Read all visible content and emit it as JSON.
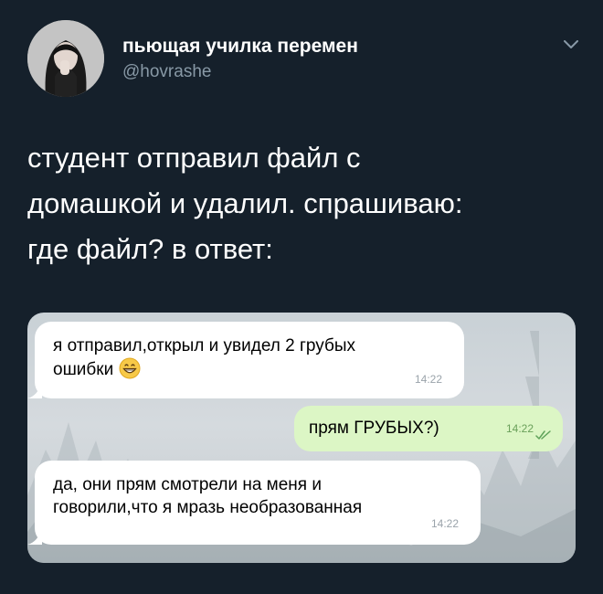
{
  "tweet": {
    "display_name": "пьющая училка перемен",
    "handle": "@hovrashe",
    "text_lines": [
      "студент отправил файл с",
      "домашкой и удалил. спрашиваю:",
      "где файл? в ответ:"
    ]
  },
  "chat": {
    "messages": [
      {
        "lines": [
          "я отправил,открыл и увидел 2 грубых",
          "ошибки"
        ],
        "time": "14:22",
        "emoji": "grinning-face-emoji"
      },
      {
        "lines": [
          "прям ГРУБЫХ?)"
        ],
        "time": "14:22",
        "status_icon": "double-check-icon"
      },
      {
        "lines": [
          "да, они прям смотрели на меня и",
          "говорили,что я мразь необразованная"
        ],
        "time": "14:22"
      }
    ]
  },
  "colors": {
    "background": "#15202b",
    "handle": "#8899a6",
    "incoming_bubble": "#ffffff",
    "outgoing_bubble": "#dcf6c5"
  }
}
